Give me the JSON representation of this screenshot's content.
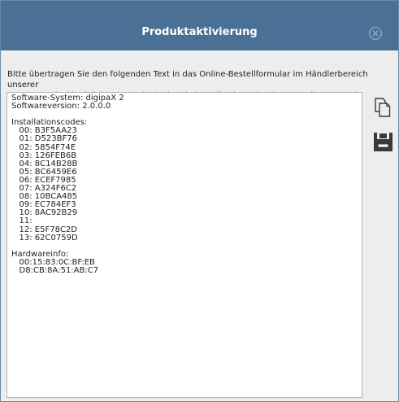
{
  "window": {
    "title": "Produktaktivierung"
  },
  "instructions": "Bitte übertragen Sie den folgenden Text in das Online-Bestellformular im Händlerbereich unserer\nHomepage (Feld: Aktivierungscodes). Sie erhalten die Lizenzdatei per eMail zugesandt.",
  "codebox": {
    "content": "Software-System: digipaX 2\nSoftwareversion: 2.0.0.0\n\nInstallationscodes:\n   00: B3F5AA23\n   01: D523BF76\n   02: 5854F74E\n   03: 126FEB6B\n   04: 8C14B28B\n   05: BC6459E6\n   06: ECEF7985\n   07: A324F6C2\n   08: 10BCA485\n   09: EC784EF3\n   10: 8AC92B29\n   11:\n   12: E5F78C2D\n   13: 62C0759D\n\nHardwareinfo:\n   00:15:83:0C:BF:EB\n   D8:CB:8A:51:AB:C7"
  },
  "icons": {
    "close": "close-circle-icon",
    "copy": "copy-icon",
    "save": "save-icon"
  },
  "colors": {
    "titlebar": "#4b7096",
    "background": "#ededed",
    "icon": "#3a3a3a"
  }
}
